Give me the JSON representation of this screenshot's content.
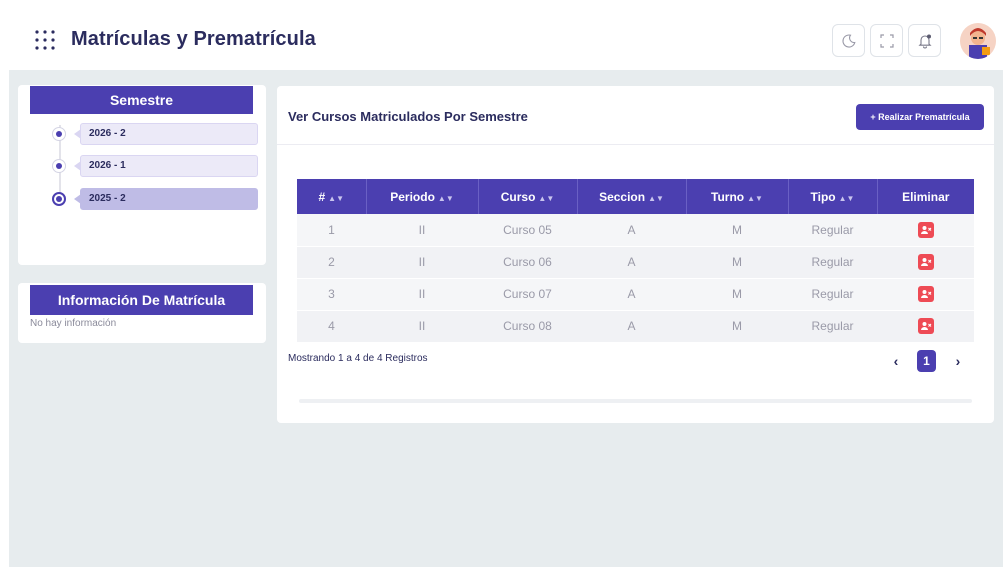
{
  "header": {
    "title": "Matrículas y Prematrícula",
    "icons": [
      "apps-grid-icon",
      "dark-mode-moon-icon",
      "fullscreen-icon",
      "notification-bell-icon"
    ]
  },
  "semestre": {
    "title": "Semestre",
    "items": [
      {
        "label": "2026 - 2",
        "active": false
      },
      {
        "label": "2026 - 1",
        "active": false
      },
      {
        "label": "2025 - 2",
        "active": true
      }
    ]
  },
  "info": {
    "title": "Información De Matrícula",
    "empty_text": "No hay información"
  },
  "main": {
    "title": "Ver Cursos Matriculados Por Semestre",
    "add_button": "+ Realizar Prematrícula",
    "columns": [
      "#",
      "Periodo",
      "Curso",
      "Seccion",
      "Turno",
      "Tipo",
      "Eliminar"
    ],
    "rows": [
      [
        "1",
        "II",
        "Curso 05",
        "A",
        "M",
        "Regular"
      ],
      [
        "2",
        "II",
        "Curso 06",
        "A",
        "M",
        "Regular"
      ],
      [
        "3",
        "II",
        "Curso 07",
        "A",
        "M",
        "Regular"
      ],
      [
        "4",
        "II",
        "Curso 08",
        "A",
        "M",
        "Regular"
      ]
    ],
    "footer_text": "Mostrando 1 a 4 de 4 Registros",
    "pagination": {
      "prev": "‹",
      "current": "1",
      "next": "›"
    }
  },
  "colors": {
    "primary": "#4b3fb0",
    "danger": "#ee4b55",
    "page_bg": "#e7ecee"
  }
}
